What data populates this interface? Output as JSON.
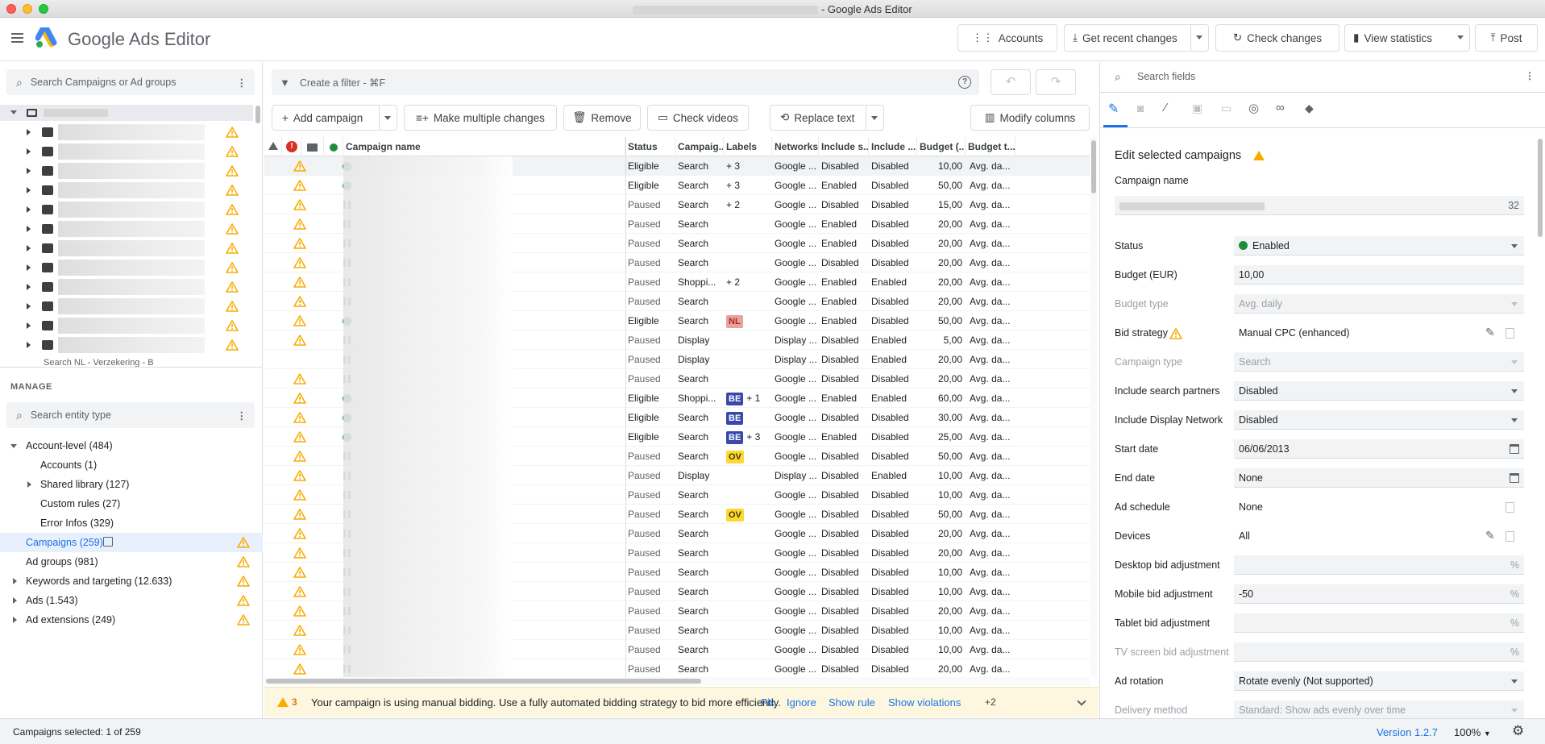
{
  "window": {
    "title": "- Google Ads Editor"
  },
  "app": {
    "name": "Google Ads Editor"
  },
  "toolbar": {
    "accounts": "Accounts",
    "get_recent": "Get recent changes",
    "check_changes": "Check changes",
    "view_stats": "View statistics",
    "post": "Post"
  },
  "left": {
    "search_placeholder": "Search Campaigns or Ad groups",
    "truncated_item": "Search NL - Verzekering - B",
    "manage_title": "MANAGE",
    "entity_placeholder": "Search entity type",
    "tree": [
      {
        "label": "Account-level (484)",
        "level": 0,
        "expanded": true,
        "warn": false
      },
      {
        "label": "Accounts (1)",
        "level": 1,
        "warn": false
      },
      {
        "label": "Shared library (127)",
        "level": 1,
        "expandable": true,
        "warn": false
      },
      {
        "label": "Custom rules (27)",
        "level": 1,
        "warn": false
      },
      {
        "label": "Error Infos (329)",
        "level": 1,
        "warn": false
      },
      {
        "label": "Campaigns (259)",
        "level": 0,
        "selected": true,
        "warn": true
      },
      {
        "label": "Ad groups (981)",
        "level": 0,
        "warn": true
      },
      {
        "label": "Keywords and targeting (12.633)",
        "level": 0,
        "expandable": true,
        "warn": true
      },
      {
        "label": "Ads (1.543)",
        "level": 0,
        "expandable": true,
        "warn": true
      },
      {
        "label": "Ad extensions (249)",
        "level": 0,
        "expandable": true,
        "warn": true
      }
    ]
  },
  "center": {
    "filter_placeholder": "Create a filter - ⌘F",
    "add_campaign": "Add campaign",
    "make_changes": "Make multiple changes",
    "remove": "Remove",
    "check_videos": "Check videos",
    "replace_text": "Replace text",
    "modify_columns": "Modify columns",
    "columns": [
      "Campaign name",
      "Status",
      "Campaig...",
      "Labels",
      "Networks",
      "Include s...",
      "Include ...",
      "Budget (...",
      "Budget t..."
    ],
    "rows": [
      {
        "st": "on",
        "status": "Eligible",
        "type": "Search",
        "labels": [],
        "extra": "+ 3",
        "net": "Google ...",
        "s1": "Disabled",
        "s2": "Disabled",
        "budget": "10,00",
        "btype": "Avg. da..."
      },
      {
        "st": "on",
        "status": "Eligible",
        "type": "Search",
        "labels": [],
        "extra": "+ 3",
        "net": "Google ...",
        "s1": "Enabled",
        "s2": "Disabled",
        "budget": "50,00",
        "btype": "Avg. da..."
      },
      {
        "st": "pause",
        "status": "Paused",
        "type": "Search",
        "labels": [],
        "extra": "+ 2",
        "net": "Google ...",
        "s1": "Disabled",
        "s2": "Disabled",
        "budget": "15,00",
        "btype": "Avg. da..."
      },
      {
        "st": "pause",
        "status": "Paused",
        "type": "Search",
        "labels": [],
        "extra": "",
        "net": "Google ...",
        "s1": "Enabled",
        "s2": "Disabled",
        "budget": "20,00",
        "btype": "Avg. da..."
      },
      {
        "st": "pause",
        "status": "Paused",
        "type": "Search",
        "labels": [],
        "extra": "",
        "net": "Google ...",
        "s1": "Enabled",
        "s2": "Disabled",
        "budget": "20,00",
        "btype": "Avg. da..."
      },
      {
        "st": "pause",
        "status": "Paused",
        "type": "Search",
        "labels": [],
        "extra": "",
        "net": "Google ...",
        "s1": "Disabled",
        "s2": "Disabled",
        "budget": "20,00",
        "btype": "Avg. da..."
      },
      {
        "st": "pause",
        "status": "Paused",
        "type": "Shoppi...",
        "labels": [],
        "extra": "+ 2",
        "net": "Google ...",
        "s1": "Enabled",
        "s2": "Enabled",
        "budget": "20,00",
        "btype": "Avg. da..."
      },
      {
        "st": "pause",
        "status": "Paused",
        "type": "Search",
        "labels": [],
        "extra": "",
        "net": "Google ...",
        "s1": "Enabled",
        "s2": "Disabled",
        "budget": "20,00",
        "btype": "Avg. da..."
      },
      {
        "st": "on",
        "status": "Eligible",
        "type": "Search",
        "labels": [
          "NL"
        ],
        "extra": "",
        "net": "Google ...",
        "s1": "Enabled",
        "s2": "Disabled",
        "budget": "50,00",
        "btype": "Avg. da..."
      },
      {
        "st": "pause",
        "status": "Paused",
        "type": "Display",
        "labels": [],
        "extra": "",
        "net": "Display ...",
        "s1": "Disabled",
        "s2": "Enabled",
        "budget": "5,00",
        "btype": "Avg. da..."
      },
      {
        "st": "pause",
        "nowarn": true,
        "status": "Paused",
        "type": "Display",
        "labels": [],
        "extra": "",
        "net": "Display ...",
        "s1": "Disabled",
        "s2": "Enabled",
        "budget": "20,00",
        "btype": "Avg. da..."
      },
      {
        "st": "pause",
        "status": "Paused",
        "type": "Search",
        "labels": [],
        "extra": "",
        "net": "Google ...",
        "s1": "Disabled",
        "s2": "Disabled",
        "budget": "20,00",
        "btype": "Avg. da..."
      },
      {
        "st": "on",
        "status": "Eligible",
        "type": "Shoppi...",
        "labels": [
          "BE"
        ],
        "extra": "+ 1",
        "net": "Google ...",
        "s1": "Enabled",
        "s2": "Enabled",
        "budget": "60,00",
        "btype": "Avg. da..."
      },
      {
        "st": "on",
        "status": "Eligible",
        "type": "Search",
        "labels": [
          "BE"
        ],
        "extra": "",
        "net": "Google ...",
        "s1": "Disabled",
        "s2": "Disabled",
        "budget": "30,00",
        "btype": "Avg. da..."
      },
      {
        "st": "on",
        "status": "Eligible",
        "type": "Search",
        "labels": [
          "BE"
        ],
        "extra": "+ 3",
        "net": "Google ...",
        "s1": "Enabled",
        "s2": "Disabled",
        "budget": "25,00",
        "btype": "Avg. da..."
      },
      {
        "st": "pause",
        "status": "Paused",
        "type": "Search",
        "labels": [
          "OV"
        ],
        "extra": "",
        "net": "Google ...",
        "s1": "Disabled",
        "s2": "Disabled",
        "budget": "50,00",
        "btype": "Avg. da..."
      },
      {
        "st": "pause",
        "status": "Paused",
        "type": "Display",
        "labels": [],
        "extra": "",
        "net": "Display ...",
        "s1": "Disabled",
        "s2": "Enabled",
        "budget": "10,00",
        "btype": "Avg. da..."
      },
      {
        "st": "pause",
        "status": "Paused",
        "type": "Search",
        "labels": [],
        "extra": "",
        "net": "Google ...",
        "s1": "Disabled",
        "s2": "Disabled",
        "budget": "10,00",
        "btype": "Avg. da..."
      },
      {
        "st": "pause",
        "status": "Paused",
        "type": "Search",
        "labels": [
          "OV"
        ],
        "extra": "",
        "net": "Google ...",
        "s1": "Disabled",
        "s2": "Disabled",
        "budget": "50,00",
        "btype": "Avg. da..."
      },
      {
        "st": "pause",
        "status": "Paused",
        "type": "Search",
        "labels": [],
        "extra": "",
        "net": "Google ...",
        "s1": "Disabled",
        "s2": "Disabled",
        "budget": "20,00",
        "btype": "Avg. da..."
      },
      {
        "st": "pause",
        "status": "Paused",
        "type": "Search",
        "labels": [],
        "extra": "",
        "net": "Google ...",
        "s1": "Disabled",
        "s2": "Disabled",
        "budget": "20,00",
        "btype": "Avg. da..."
      },
      {
        "st": "pause",
        "status": "Paused",
        "type": "Search",
        "labels": [],
        "extra": "",
        "net": "Google ...",
        "s1": "Disabled",
        "s2": "Disabled",
        "budget": "10,00",
        "btype": "Avg. da..."
      },
      {
        "st": "pause",
        "status": "Paused",
        "type": "Search",
        "labels": [],
        "extra": "",
        "net": "Google ...",
        "s1": "Disabled",
        "s2": "Disabled",
        "budget": "10,00",
        "btype": "Avg. da..."
      },
      {
        "st": "pause",
        "status": "Paused",
        "type": "Search",
        "labels": [],
        "extra": "",
        "net": "Google ...",
        "s1": "Disabled",
        "s2": "Disabled",
        "budget": "20,00",
        "btype": "Avg. da..."
      },
      {
        "st": "pause",
        "status": "Paused",
        "type": "Search",
        "labels": [],
        "extra": "",
        "net": "Google ...",
        "s1": "Disabled",
        "s2": "Disabled",
        "budget": "10,00",
        "btype": "Avg. da..."
      },
      {
        "st": "pause",
        "status": "Paused",
        "type": "Search",
        "labels": [],
        "extra": "",
        "net": "Google ...",
        "s1": "Disabled",
        "s2": "Disabled",
        "budget": "10,00",
        "btype": "Avg. da..."
      },
      {
        "st": "pause",
        "status": "Paused",
        "type": "Search",
        "labels": [],
        "extra": "",
        "net": "Google ...",
        "s1": "Disabled",
        "s2": "Disabled",
        "budget": "20,00",
        "btype": "Avg. da..."
      }
    ]
  },
  "label_colors": {
    "NL": "#e8a0a0",
    "BE": "#3949ab",
    "OV": "#fdd835"
  },
  "notice": {
    "count": "3",
    "message": "Your campaign is using manual bidding. Use a fully automated bidding strategy to bid more efficiently.",
    "fix": "Fix",
    "ignore": "Ignore",
    "show_rule": "Show rule",
    "show_violations": "Show violations",
    "more": "+2"
  },
  "right": {
    "search_placeholder": "Search fields",
    "heading": "Edit selected campaigns",
    "campaign_name_label": "Campaign name",
    "campaign_name_count": "32",
    "fields": [
      {
        "label": "Status",
        "value": "Enabled",
        "kind": "dropdown",
        "dot": true
      },
      {
        "label": "Budget (EUR)",
        "value": "10,00",
        "kind": "input"
      },
      {
        "label": "Budget type",
        "value": "Avg. daily",
        "kind": "dropdown",
        "disabled": true
      },
      {
        "label": "Bid strategy",
        "value": "Manual CPC (enhanced)",
        "kind": "edit",
        "warn": true
      },
      {
        "label": "Campaign type",
        "value": "Search",
        "kind": "dropdown",
        "disabled": true
      },
      {
        "label": "Include search partners",
        "value": "Disabled",
        "kind": "dropdown"
      },
      {
        "label": "Include Display Network",
        "value": "Disabled",
        "kind": "dropdown"
      },
      {
        "label": "Start date",
        "value": "06/06/2013",
        "kind": "date"
      },
      {
        "label": "End date",
        "value": "None",
        "kind": "date"
      },
      {
        "label": "Ad schedule",
        "value": "None",
        "kind": "plain"
      },
      {
        "label": "Devices",
        "value": "All",
        "kind": "edit"
      },
      {
        "label": "Desktop bid adjustment",
        "value": "",
        "kind": "pct"
      },
      {
        "label": "Mobile bid adjustment",
        "value": "-50",
        "kind": "pct"
      },
      {
        "label": "Tablet bid adjustment",
        "value": "",
        "kind": "pct"
      },
      {
        "label": "TV screen bid adjustment",
        "value": "",
        "kind": "pct",
        "disabled": true
      },
      {
        "label": "Ad rotation",
        "value": "Rotate evenly (Not supported)",
        "kind": "dropdown"
      },
      {
        "label": "Delivery method",
        "value": "Standard: Show ads evenly over time",
        "kind": "dropdown",
        "disabled": true
      }
    ]
  },
  "status": {
    "selected": "Campaigns selected: 1 of 259",
    "version": "Version 1.2.7",
    "zoom": "100%"
  },
  "colors": {
    "green": "#1e8e3e",
    "warn": "#f9ab00",
    "blue": "#1a73e8"
  }
}
